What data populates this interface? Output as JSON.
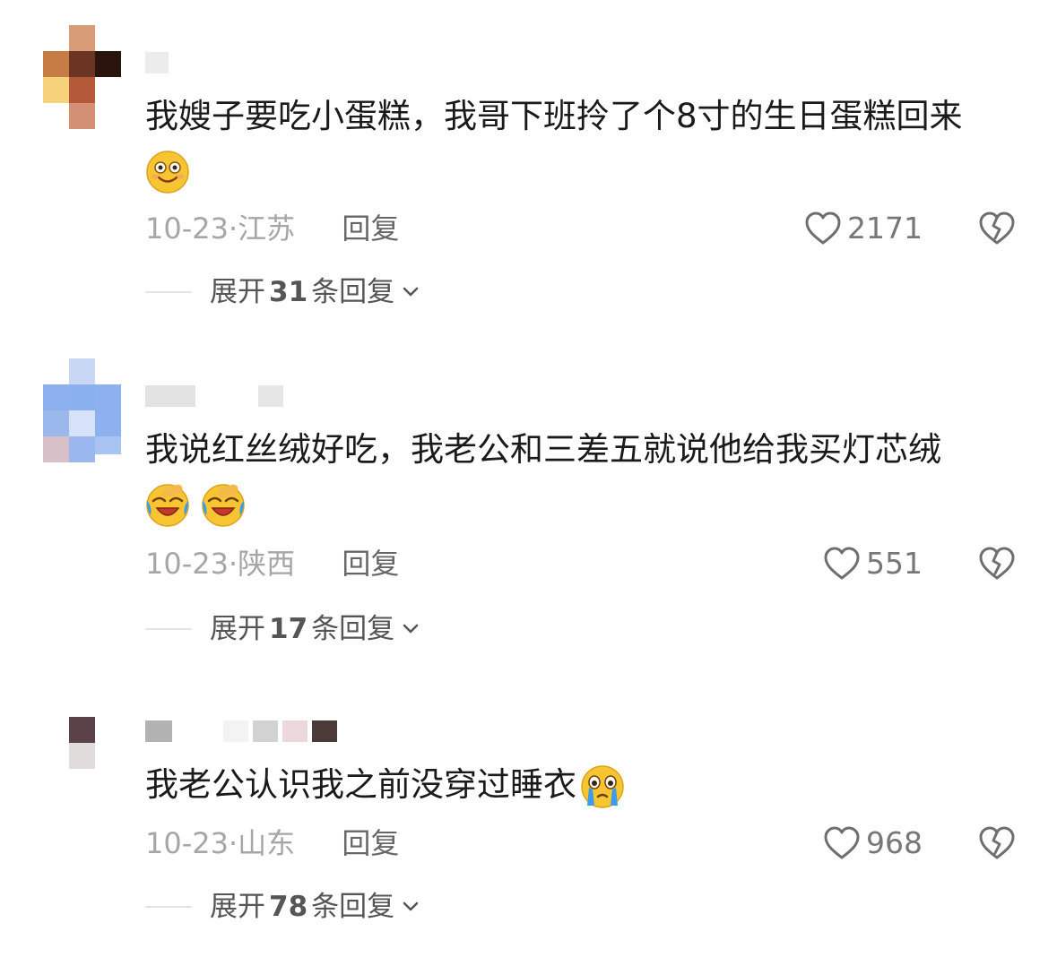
{
  "comments": [
    {
      "text": "我嫂子要吃小蛋糕，我哥下班拎了个8寸的生日蛋糕回来",
      "emojis": [
        "smile-icon"
      ],
      "date": "10-23",
      "location": "江苏",
      "reply_label": "回复",
      "likes": "2171",
      "expand_prefix": "展开",
      "expand_count": "31",
      "expand_suffix": "条回复"
    },
    {
      "text": "我说红丝绒好吃，我老公和三差五就说他给我买灯芯绒",
      "emojis": [
        "laugh-cry-icon",
        "laugh-cry-icon"
      ],
      "date": "10-23",
      "location": "陕西",
      "reply_label": "回复",
      "likes": "551",
      "expand_prefix": "展开",
      "expand_count": "17",
      "expand_suffix": "条回复"
    },
    {
      "text": "我老公认识我之前没穿过睡衣",
      "emojis": [
        "teary-eyes-icon"
      ],
      "date": "10-23",
      "location": "山东",
      "reply_label": "回复",
      "likes": "968",
      "expand_prefix": "展开",
      "expand_count": "78",
      "expand_suffix": "条回复"
    }
  ],
  "date_separator": "·",
  "icons": {
    "like": "heart-outline-icon",
    "dislike": "broken-heart-icon",
    "expand": "chevron-down-icon"
  },
  "colors": {
    "meta_gray": "#a6a6a6",
    "reply_gray": "#666666",
    "emoji_yellow": "#f7c531",
    "tear_blue": "#3a9be8"
  }
}
